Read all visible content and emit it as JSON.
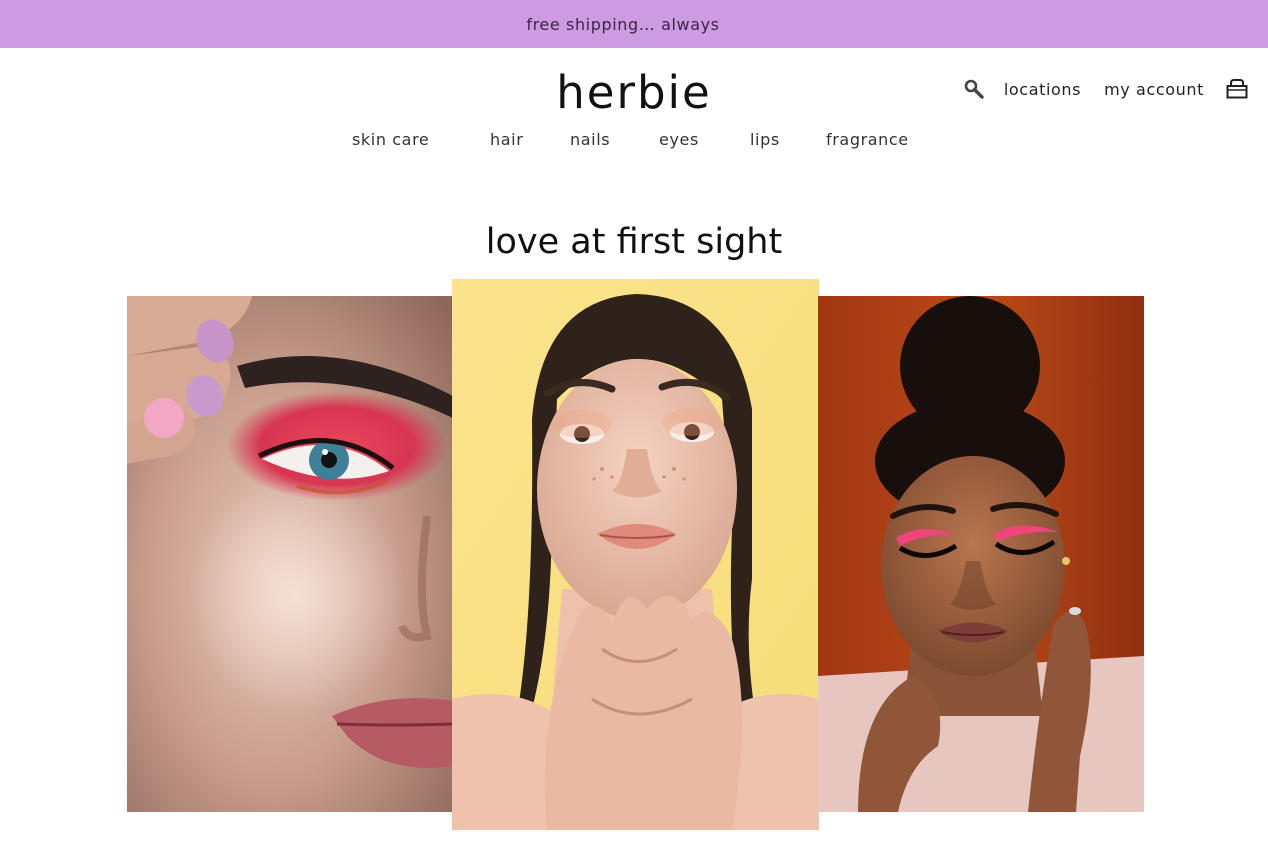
{
  "promo": {
    "text": "free shipping… always"
  },
  "brand": {
    "logo": "herbie"
  },
  "utility": {
    "search_icon": "search-icon",
    "locations_label": "locations",
    "account_label": "my account",
    "cart_icon": "shopping-bag-icon"
  },
  "nav": {
    "items": [
      {
        "label": "skin care"
      },
      {
        "label": "hair"
      },
      {
        "label": "nails"
      },
      {
        "label": "eyes"
      },
      {
        "label": "lips"
      },
      {
        "label": "fragrance"
      }
    ]
  },
  "section": {
    "title": "love at first sight"
  },
  "colors": {
    "promo_bg": "#cc9be2",
    "center_photo_bg": "#f8e17a",
    "right_photo_bg": "#9a3412"
  }
}
